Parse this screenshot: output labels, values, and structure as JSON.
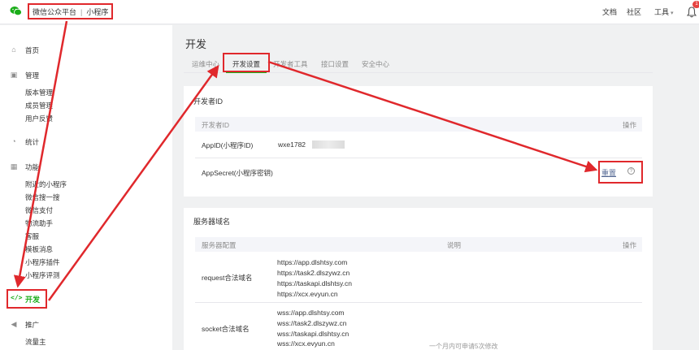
{
  "header": {
    "brand": "微信公众平台",
    "product": "小程序",
    "separator": "|",
    "nav": {
      "docs": "文档",
      "community": "社区",
      "tools": "工具"
    },
    "badge": "1"
  },
  "sidebar": {
    "home": "首页",
    "manage": "管理",
    "manage_items": [
      "版本管理",
      "成员管理",
      "用户反馈"
    ],
    "stats": "统计",
    "features": "功能",
    "feature_items": [
      "附近的小程序",
      "微信搜一搜",
      "微信支付",
      "物流助手",
      "客服",
      "模板消息",
      "小程序插件",
      "小程序评测"
    ],
    "develop": "开发",
    "develop_code": "</>",
    "promote": "推广",
    "promote_items": [
      "流量主"
    ]
  },
  "main": {
    "title": "开发",
    "tabs": [
      "运维中心",
      "开发设置",
      "开发者工具",
      "接口设置",
      "安全中心"
    ],
    "developer_id": {
      "title": "开发者ID",
      "header": {
        "name": "开发者ID",
        "action": "操作"
      },
      "rows": [
        {
          "label": "AppID(小程序ID)",
          "value": "wxe1782"
        },
        {
          "label": "AppSecret(小程序密钥)",
          "action": "重置"
        }
      ]
    },
    "server_domains": {
      "title": "服务器域名",
      "header": {
        "config": "服务器配置",
        "desc": "说明",
        "action": "操作"
      },
      "rows": [
        {
          "label": "request合法域名",
          "domains": [
            "https://app.dlshtsy.com",
            "https://task2.dlszywz.cn",
            "https://taskapi.dlshtsy.cn",
            "https://xcx.evyun.cn"
          ]
        },
        {
          "label": "socket合法域名",
          "domains": [
            "wss://app.dlshtsy.com",
            "wss://task2.dlszywz.cn",
            "wss://taskapi.dlshtsy.cn",
            "wss://xcx.evyun.cn"
          ]
        }
      ],
      "note": "一个月内可申请5次修改"
    }
  },
  "colors": {
    "accent": "#1aad19",
    "annotation": "#e0282c",
    "link": "#576b95"
  }
}
